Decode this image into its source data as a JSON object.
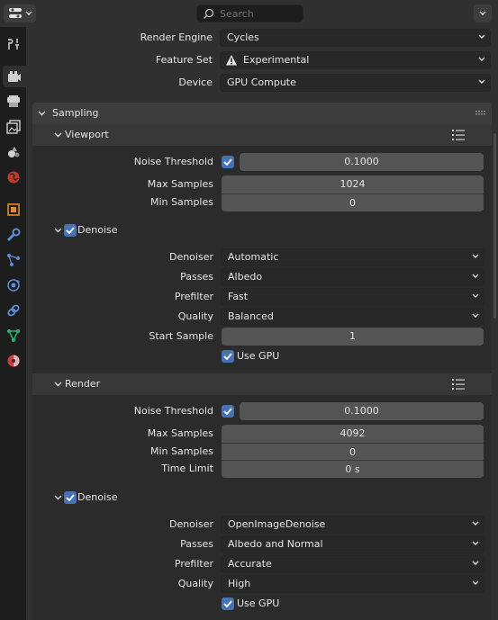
{
  "header": {
    "search_placeholder": "Search"
  },
  "render": {
    "engine_label": "Render Engine",
    "engine_value": "Cycles",
    "feature_set_label": "Feature Set",
    "feature_set_value": "Experimental",
    "device_label": "Device",
    "device_value": "GPU Compute"
  },
  "sampling": {
    "title": "Sampling",
    "viewport": {
      "title": "Viewport",
      "noise_threshold_label": "Noise Threshold",
      "noise_threshold_value": "0.1000",
      "max_samples_label": "Max Samples",
      "max_samples_value": "1024",
      "min_samples_label": "Min Samples",
      "min_samples_value": "0",
      "denoise": {
        "title": "Denoise",
        "denoiser_label": "Denoiser",
        "denoiser_value": "Automatic",
        "passes_label": "Passes",
        "passes_value": "Albedo",
        "prefilter_label": "Prefilter",
        "prefilter_value": "Fast",
        "quality_label": "Quality",
        "quality_value": "Balanced",
        "start_sample_label": "Start Sample",
        "start_sample_value": "1",
        "use_gpu_label": "Use GPU"
      }
    },
    "render": {
      "title": "Render",
      "noise_threshold_label": "Noise Threshold",
      "noise_threshold_value": "0.1000",
      "max_samples_label": "Max Samples",
      "max_samples_value": "4092",
      "min_samples_label": "Min Samples",
      "min_samples_value": "0",
      "time_limit_label": "Time Limit",
      "time_limit_value": "0 s",
      "denoise": {
        "title": "Denoise",
        "denoiser_label": "Denoiser",
        "denoiser_value": "OpenImageDenoise",
        "passes_label": "Passes",
        "passes_value": "Albedo and Normal",
        "prefilter_label": "Prefilter",
        "prefilter_value": "Accurate",
        "quality_label": "Quality",
        "quality_value": "High",
        "use_gpu_label": "Use GPU"
      }
    }
  },
  "sidebar_tabs": [
    "tool-icon",
    "render-icon",
    "output-icon",
    "view-layer-icon",
    "scene-icon",
    "world-icon",
    "object-icon",
    "modifier-icon",
    "particles-icon",
    "physics-icon",
    "constraints-icon",
    "data-icon",
    "material-icon"
  ],
  "colors": {
    "accent": "#4772b3",
    "background": "#303030",
    "sidebar": "#1d1d1d"
  }
}
